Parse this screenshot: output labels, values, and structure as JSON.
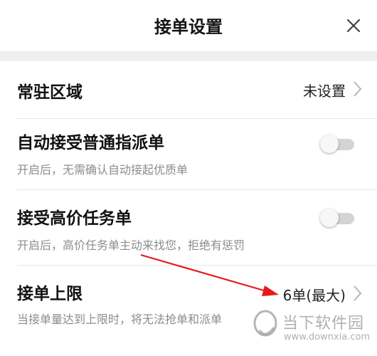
{
  "header": {
    "title": "接单设置",
    "close_icon": "close-icon"
  },
  "rows": [
    {
      "label": "常驻区域",
      "value": "未设置",
      "icon": "chevron-right-icon"
    },
    {
      "label": "自动接受普通指派单",
      "description": "开启后，无需确认自动接起优质单",
      "toggle_on": false
    },
    {
      "label": "接受高价任务单",
      "description": "开启后，高价任务单主动来找您，拒绝有惩罚",
      "toggle_on": false
    },
    {
      "label": "接单上限",
      "description": "当接单量达到上限时，将无法抢单和派单",
      "value": "6单(最大)",
      "icon": "chevron-right-icon"
    }
  ],
  "annotation": {
    "arrow_color": "#e8191b"
  },
  "watermark": {
    "text": "当下软件园",
    "url_text": "www.downxia.com"
  },
  "colors": {
    "separator": "#efefef",
    "toggle_track": "#d4d4d4",
    "secondary_text": "#8c8c8c"
  }
}
